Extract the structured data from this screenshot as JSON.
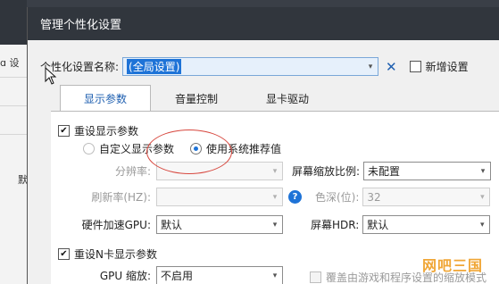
{
  "background_app": {
    "partial_text": "ɑ 设",
    "partial_mark": "默"
  },
  "dialog": {
    "title": "管理个性化设置"
  },
  "profile": {
    "label": "个性化设置名称:",
    "selected_value": "(全局设置)",
    "new_setting_label": "新增设置"
  },
  "tabs": [
    {
      "label": "显示参数",
      "active": true
    },
    {
      "label": "音量控制",
      "active": false
    },
    {
      "label": "显卡驱动",
      "active": false
    }
  ],
  "display": {
    "reset_label": "重设显示参数",
    "radio_custom_label": "自定义显示参数",
    "radio_recommended_label": "使用系统推荐值",
    "resolution_label": "分辨率:",
    "scaling_label": "屏幕缩放比例:",
    "scaling_value": "未配置",
    "refresh_label": "刷新率(HZ):",
    "help_icon_text": "?",
    "color_depth_label": "色深(位):",
    "color_depth_value": "32",
    "hw_accel_label": "硬件加速GPU:",
    "hw_accel_value": "默认",
    "hdr_label": "屏幕HDR:",
    "hdr_value": "默认"
  },
  "gpu": {
    "reset_label": "重设N卡显示参数",
    "scaling_label": "GPU 缩放:",
    "scaling_value": "不启用",
    "override_label": "覆盖由游戏和程序设置的缩放模式"
  },
  "watermark": "网吧三国",
  "colors": {
    "titlebar": "#31363d",
    "accent": "#1e73d7",
    "annotation": "#d7473e",
    "watermark": "#f0a636"
  }
}
